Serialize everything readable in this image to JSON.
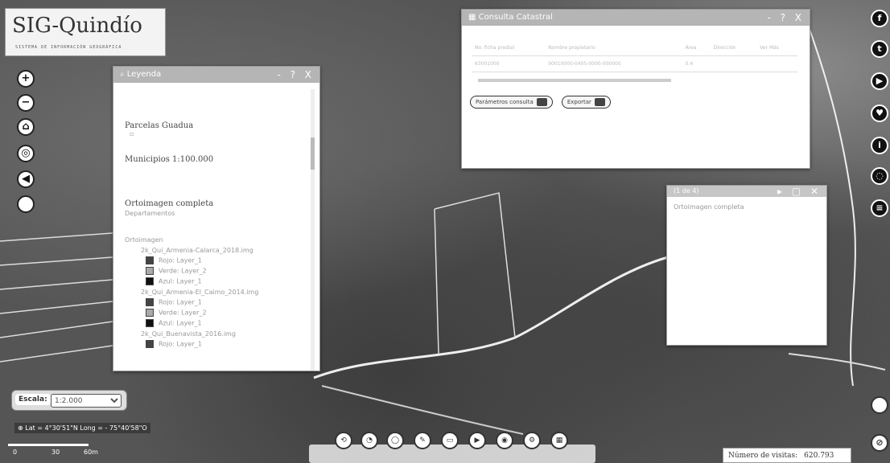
{
  "logo": {
    "title": "SIG-Quindío",
    "subtitle": "SISTEMA DE INFORMACIÓN GEOGRÁFICA"
  },
  "map_controls": [
    {
      "icon": "zoom-in-icon",
      "glyph": "+"
    },
    {
      "icon": "zoom-out-icon",
      "glyph": "−"
    },
    {
      "icon": "home-icon",
      "glyph": "⌂"
    },
    {
      "icon": "locate-icon",
      "glyph": "◎"
    },
    {
      "icon": "back-icon",
      "glyph": "◀"
    },
    {
      "icon": "blank-icon",
      "glyph": ""
    }
  ],
  "legend": {
    "title": "Leyenda",
    "window_buttons": "- ? X",
    "sections": [
      "Parcelas Guadua",
      "Municipios 1:100.000",
      "Ortoimagen completa"
    ],
    "sub_label": "Departamentos",
    "group_header": "Ortoimagen",
    "layers": [
      {
        "name": "2k_Qui_Armenia-Calarca_2018.img",
        "bands": [
          "Rojo: Layer_1",
          "Verde: Layer_2",
          "Azul: Layer_1"
        ]
      },
      {
        "name": "2k_Qui_Armenia-El_Caimo_2014.img",
        "bands": [
          "Rojo: Layer_1",
          "Verde: Layer_2",
          "Azul: Layer_1"
        ]
      },
      {
        "name": "2k_Qui_Buenavista_2016.img",
        "bands": [
          "Rojo: Layer_1"
        ]
      }
    ]
  },
  "consulta": {
    "title": "Consulta Catastral",
    "window_buttons": "- ? X",
    "row1": [
      "No. ficha predial",
      "Nombre propietario",
      "",
      "Área",
      "Dirección",
      "Ver Más"
    ],
    "row2": [
      "63001000",
      "00010000-0405-0000-000000",
      "",
      "0.4",
      "",
      ""
    ],
    "btn_params": "Parámetros consulta",
    "btn_export": "Exportar"
  },
  "popup": {
    "title": "(1 de 4)",
    "body": "Ortoimagen completa"
  },
  "social": [
    "f",
    "t",
    "▶",
    "♥",
    "i",
    "◌",
    "≡"
  ],
  "escala": {
    "label": "Escala:",
    "value": "1:2.000"
  },
  "coords": "Lat = 4°30'51\"N Long = - 75°40'58\"O",
  "scalebar": {
    "l0": "0",
    "l1": "30",
    "l2": "60m"
  },
  "toolbar_icons": [
    "⟲",
    "◔",
    "◯",
    "✎",
    "▭",
    "▶",
    "◉",
    "⚙",
    "▦"
  ],
  "visits": {
    "label": "Número de visitas:",
    "value": "620.793"
  }
}
